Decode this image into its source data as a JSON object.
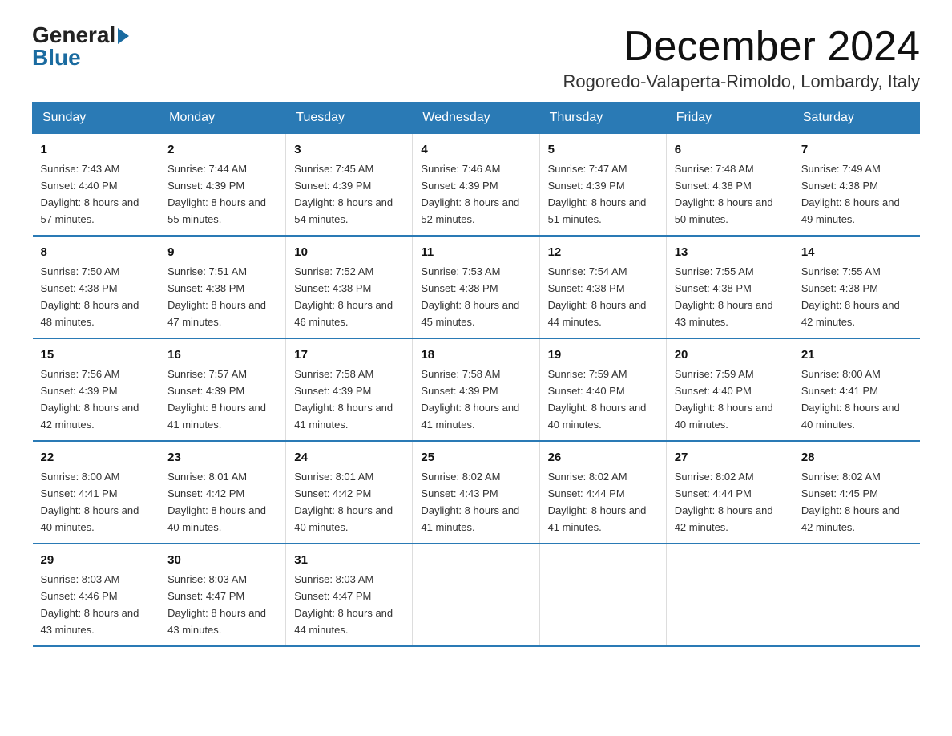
{
  "logo": {
    "general": "General",
    "blue": "Blue"
  },
  "title": "December 2024",
  "location": "Rogoredo-Valaperta-Rimoldo, Lombardy, Italy",
  "days_of_week": [
    "Sunday",
    "Monday",
    "Tuesday",
    "Wednesday",
    "Thursday",
    "Friday",
    "Saturday"
  ],
  "weeks": [
    [
      {
        "day": "1",
        "sunrise": "7:43 AM",
        "sunset": "4:40 PM",
        "daylight": "8 hours and 57 minutes."
      },
      {
        "day": "2",
        "sunrise": "7:44 AM",
        "sunset": "4:39 PM",
        "daylight": "8 hours and 55 minutes."
      },
      {
        "day": "3",
        "sunrise": "7:45 AM",
        "sunset": "4:39 PM",
        "daylight": "8 hours and 54 minutes."
      },
      {
        "day": "4",
        "sunrise": "7:46 AM",
        "sunset": "4:39 PM",
        "daylight": "8 hours and 52 minutes."
      },
      {
        "day": "5",
        "sunrise": "7:47 AM",
        "sunset": "4:39 PM",
        "daylight": "8 hours and 51 minutes."
      },
      {
        "day": "6",
        "sunrise": "7:48 AM",
        "sunset": "4:38 PM",
        "daylight": "8 hours and 50 minutes."
      },
      {
        "day": "7",
        "sunrise": "7:49 AM",
        "sunset": "4:38 PM",
        "daylight": "8 hours and 49 minutes."
      }
    ],
    [
      {
        "day": "8",
        "sunrise": "7:50 AM",
        "sunset": "4:38 PM",
        "daylight": "8 hours and 48 minutes."
      },
      {
        "day": "9",
        "sunrise": "7:51 AM",
        "sunset": "4:38 PM",
        "daylight": "8 hours and 47 minutes."
      },
      {
        "day": "10",
        "sunrise": "7:52 AM",
        "sunset": "4:38 PM",
        "daylight": "8 hours and 46 minutes."
      },
      {
        "day": "11",
        "sunrise": "7:53 AM",
        "sunset": "4:38 PM",
        "daylight": "8 hours and 45 minutes."
      },
      {
        "day": "12",
        "sunrise": "7:54 AM",
        "sunset": "4:38 PM",
        "daylight": "8 hours and 44 minutes."
      },
      {
        "day": "13",
        "sunrise": "7:55 AM",
        "sunset": "4:38 PM",
        "daylight": "8 hours and 43 minutes."
      },
      {
        "day": "14",
        "sunrise": "7:55 AM",
        "sunset": "4:38 PM",
        "daylight": "8 hours and 42 minutes."
      }
    ],
    [
      {
        "day": "15",
        "sunrise": "7:56 AM",
        "sunset": "4:39 PM",
        "daylight": "8 hours and 42 minutes."
      },
      {
        "day": "16",
        "sunrise": "7:57 AM",
        "sunset": "4:39 PM",
        "daylight": "8 hours and 41 minutes."
      },
      {
        "day": "17",
        "sunrise": "7:58 AM",
        "sunset": "4:39 PM",
        "daylight": "8 hours and 41 minutes."
      },
      {
        "day": "18",
        "sunrise": "7:58 AM",
        "sunset": "4:39 PM",
        "daylight": "8 hours and 41 minutes."
      },
      {
        "day": "19",
        "sunrise": "7:59 AM",
        "sunset": "4:40 PM",
        "daylight": "8 hours and 40 minutes."
      },
      {
        "day": "20",
        "sunrise": "7:59 AM",
        "sunset": "4:40 PM",
        "daylight": "8 hours and 40 minutes."
      },
      {
        "day": "21",
        "sunrise": "8:00 AM",
        "sunset": "4:41 PM",
        "daylight": "8 hours and 40 minutes."
      }
    ],
    [
      {
        "day": "22",
        "sunrise": "8:00 AM",
        "sunset": "4:41 PM",
        "daylight": "8 hours and 40 minutes."
      },
      {
        "day": "23",
        "sunrise": "8:01 AM",
        "sunset": "4:42 PM",
        "daylight": "8 hours and 40 minutes."
      },
      {
        "day": "24",
        "sunrise": "8:01 AM",
        "sunset": "4:42 PM",
        "daylight": "8 hours and 40 minutes."
      },
      {
        "day": "25",
        "sunrise": "8:02 AM",
        "sunset": "4:43 PM",
        "daylight": "8 hours and 41 minutes."
      },
      {
        "day": "26",
        "sunrise": "8:02 AM",
        "sunset": "4:44 PM",
        "daylight": "8 hours and 41 minutes."
      },
      {
        "day": "27",
        "sunrise": "8:02 AM",
        "sunset": "4:44 PM",
        "daylight": "8 hours and 42 minutes."
      },
      {
        "day": "28",
        "sunrise": "8:02 AM",
        "sunset": "4:45 PM",
        "daylight": "8 hours and 42 minutes."
      }
    ],
    [
      {
        "day": "29",
        "sunrise": "8:03 AM",
        "sunset": "4:46 PM",
        "daylight": "8 hours and 43 minutes."
      },
      {
        "day": "30",
        "sunrise": "8:03 AM",
        "sunset": "4:47 PM",
        "daylight": "8 hours and 43 minutes."
      },
      {
        "day": "31",
        "sunrise": "8:03 AM",
        "sunset": "4:47 PM",
        "daylight": "8 hours and 44 minutes."
      },
      {
        "day": "",
        "sunrise": "",
        "sunset": "",
        "daylight": ""
      },
      {
        "day": "",
        "sunrise": "",
        "sunset": "",
        "daylight": ""
      },
      {
        "day": "",
        "sunrise": "",
        "sunset": "",
        "daylight": ""
      },
      {
        "day": "",
        "sunrise": "",
        "sunset": "",
        "daylight": ""
      }
    ]
  ]
}
